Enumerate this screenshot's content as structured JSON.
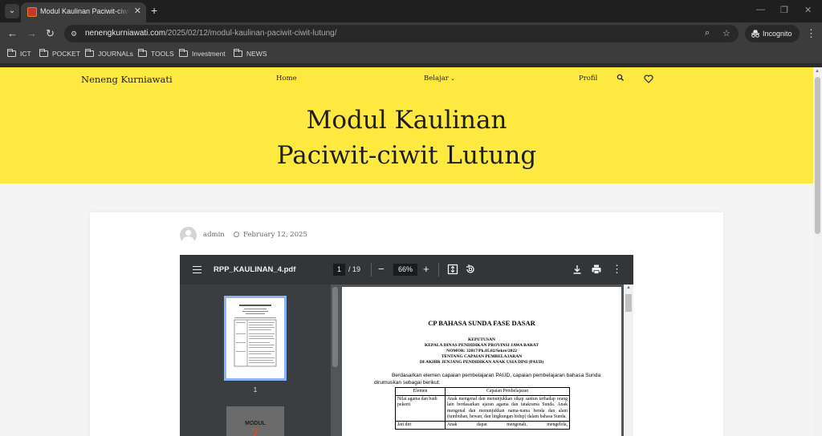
{
  "browser": {
    "tab_title": "Modul Kaulinan Paciwit-ciwit Lutung – Neneng Kurniawati",
    "url_host": "nenengkurniawati.com",
    "url_path": "/2025/02/12/modul-kaulinan-paciwit-ciwit-lutung/",
    "incognito_label": "Incognito",
    "bookmarks": [
      "ICT",
      "POCKET",
      "JOURNALs",
      "TOOLS",
      "Investment",
      "NEWS"
    ]
  },
  "site": {
    "brand": "Neneng Kurniawati",
    "nav": {
      "home": "Home",
      "belajar": "Belajar",
      "profil": "Profil"
    },
    "title_line1": "Modul Kaulinan",
    "title_line2": "Paciwit-ciwit Lutung",
    "accent_color": "#fde940"
  },
  "post": {
    "author": "admin",
    "date": "February 12, 2025"
  },
  "pdf": {
    "filename": "RPP_KAULINAN_4.pdf",
    "current_page": "1",
    "total_pages": "/ 19",
    "zoom": "66%",
    "thumb1_label": "1",
    "thumb2_title": "MODUL",
    "thumb2_number": "7",
    "doc": {
      "title": "CP BAHASA SUNDA FASE DASAR",
      "heading_lines": [
        "KEPUTUSAN",
        "KEPALA DINAS PENDIDIKAN PROVINSI JAWA BARAT",
        "NOMOR: 32817/Pk.05.02/Sekre/2022",
        "TENTANG CAPAIAN PEMBELAJARAN",
        "DI AKHIR JENJANG PENDIDIKAN ANAK USIA DINI (PAUD)"
      ],
      "paragraph": "Berdasarkan elemen capaian pembelajaran PAUD, capaian pembelajaran bahasa Sunda dirumuskan sebagai berikut:",
      "table_headers": [
        "Elemen",
        "Capaian Pembelajaran"
      ],
      "rows": [
        [
          "Nilai agama dan budi pekerti",
          "Anak mengenal dan menunjukkan sikap santun terhadap orang lain berdasarkan ajaran agama dan tatakrama Sunda. Anak mengenal dan menunjukkan nama-nama benda dan alam (tumbuhan, hewan, dan lingkungan hidup) dalam bahasa Sunda."
        ],
        [
          "Jati diri",
          "Anak dapat mengenali, mengelola,"
        ]
      ]
    }
  }
}
